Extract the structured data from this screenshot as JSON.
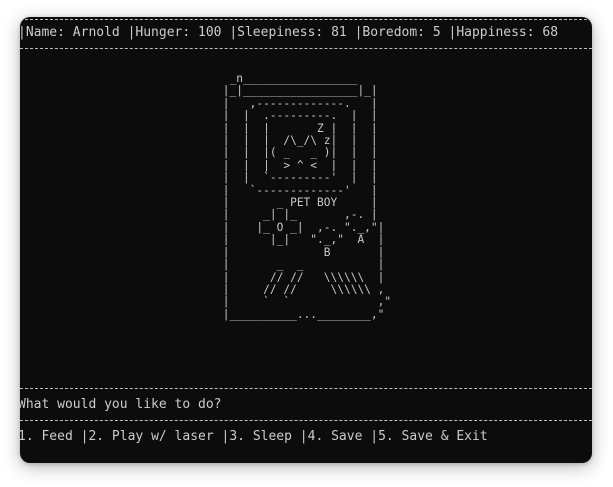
{
  "status": {
    "name_label": "Name: Arnold ",
    "hunger_label": "Hunger: 100 ",
    "sleepiness_label": "Sleepiness: 81 ",
    "boredom_label": "Boredom: 5 ",
    "happiness_label": "Happiness: 68"
  },
  "pet": {
    "name": "Arnold",
    "hunger": 100,
    "sleepiness": 81,
    "boredom": 5,
    "happiness": 68
  },
  "device_art": "  _n_________________\n |_|_________________|_|\n |   ,-------------.   |\n |  |  .---------.  |  |\n |  |  |       Z |  |  |\n |  |  |  /\\_/\\ z|  |  |\n |  |  |( _   _ )|  |  |\n |  |  |  > ^ <  |  |  |\n |  |  `---------'  |  |\n |   `-------------'   |\n |       _ PET BOY     |\n |     _| |_       ,-. |\n |    |_ O _|  ,-. \"._,\"|\n |      |_|   \"._,\"  A  |\n |              B       |\n |       _  _           |\n |      // //   \\\\\\\\\\\\  |\n |     // //     \\\\\\\\\\\\ ,\n |     `  `             ,\"\n |__________...________,\"",
  "prompt": "What would you like to do?",
  "menu": [
    "1. Feed ",
    "|2. Play w/ laser ",
    "|3. Sleep ",
    "|4. Save ",
    "|5. Save & Exit"
  ]
}
